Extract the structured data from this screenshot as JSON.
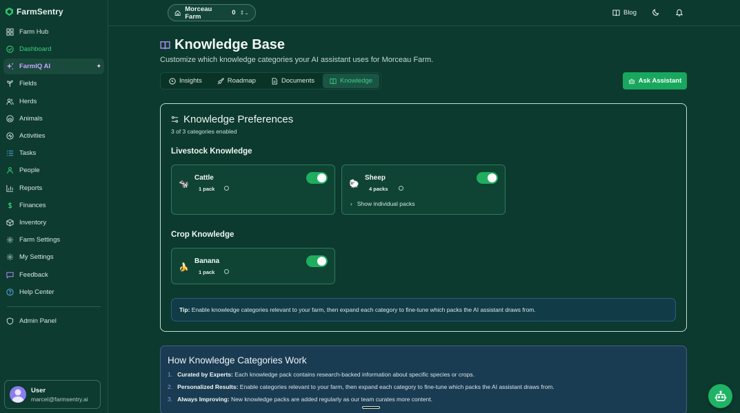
{
  "app": {
    "brand": "FarmSentry"
  },
  "sidebar": {
    "items": [
      {
        "label": "Farm Hub",
        "icon": "grid-icon"
      },
      {
        "label": "Dashboard",
        "icon": "check-circle-icon"
      },
      {
        "label": "FarmIQ AI",
        "icon": "sparkle-icon"
      },
      {
        "label": "Fields",
        "icon": "sprout-icon"
      },
      {
        "label": "Herds",
        "icon": "users-icon"
      },
      {
        "label": "Animals",
        "icon": "paw-icon"
      },
      {
        "label": "Activities",
        "icon": "activity-icon"
      },
      {
        "label": "Tasks",
        "icon": "list-icon"
      },
      {
        "label": "People",
        "icon": "people-icon"
      },
      {
        "label": "Reports",
        "icon": "bar-chart-icon"
      },
      {
        "label": "Finances",
        "icon": "dollar-icon"
      },
      {
        "label": "Inventory",
        "icon": "box-icon"
      },
      {
        "label": "Farm Settings",
        "icon": "gear-icon"
      },
      {
        "label": "My Settings",
        "icon": "gear-icon"
      },
      {
        "label": "Feedback",
        "icon": "message-icon"
      },
      {
        "label": "Help Center",
        "icon": "help-icon"
      }
    ],
    "admin": {
      "label": "Admin Panel",
      "icon": "shield-icon"
    },
    "user": {
      "name": "User",
      "email": "marcel@farmsentry.ai"
    }
  },
  "topbar": {
    "farm_name": "Morceau Farm",
    "farm_count": "0",
    "blog_label": "Blog"
  },
  "page": {
    "title": "Knowledge Base",
    "subtitle": "Customize which knowledge categories your AI assistant uses for Morceau Farm.",
    "tabs": [
      {
        "label": "Insights"
      },
      {
        "label": "Roadmap"
      },
      {
        "label": "Documents"
      },
      {
        "label": "Knowledge"
      }
    ],
    "active_tab": "Knowledge",
    "ask_button": "Ask Assistant"
  },
  "preferences": {
    "title": "Knowledge Preferences",
    "count_text": "3 of 3 categories enabled",
    "livestock_title": "Livestock Knowledge",
    "crop_title": "Crop Knowledge",
    "livestock": [
      {
        "emoji": "🐄",
        "name": "Cattle",
        "packs": "1 pack",
        "enabled": true
      },
      {
        "emoji": "🐑",
        "name": "Sheep",
        "packs": "4 packs",
        "enabled": true,
        "expand_label": "Show individual packs"
      }
    ],
    "crops": [
      {
        "emoji": "🍌",
        "name": "Banana",
        "packs": "1 pack",
        "enabled": true
      }
    ],
    "tip_label": "Tip:",
    "tip_text": " Enable knowledge categories relevant to your farm, then expand each category to fine-tune which packs the AI assistant draws from."
  },
  "how": {
    "title": "How Knowledge Categories Work",
    "items": [
      {
        "num": "1.",
        "bold": "Curated by Experts:",
        "text": " Each knowledge pack contains research-backed information about specific species or crops."
      },
      {
        "num": "2.",
        "bold": "Personalized Results:",
        "text": " Enable categories relevant to your farm, then expand each category to fine-tune which packs the AI assistant draws from."
      },
      {
        "num": "3.",
        "bold": "Always Improving:",
        "text": " New knowledge packs are added regularly as our team curates more content."
      }
    ]
  },
  "colors": {
    "background": "#0c3a2e",
    "accent_green": "#1fae5e",
    "farmiq_purple": "#c9a6ff"
  }
}
